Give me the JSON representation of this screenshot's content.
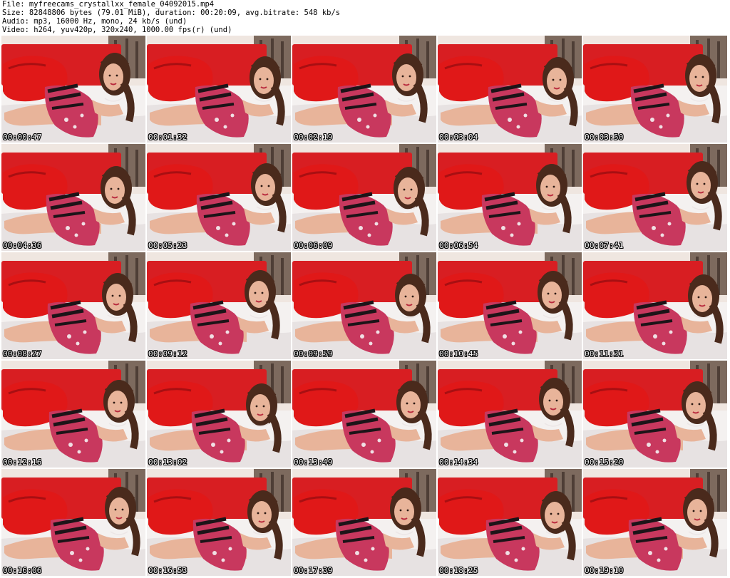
{
  "header": {
    "file": "File: myfreecams_crystallxx_female_04092015.mp4",
    "size": "Size: 82848806 bytes (79.01 MiB), duration: 00:20:09, avg.bitrate: 548 kb/s",
    "audio": "Audio: mp3, 16000 Hz, mono, 24 kb/s (und)",
    "video": "Video: h264, yuv420p, 320x240, 1000.00 fps(r) (und)"
  },
  "grid": {
    "columns": 5,
    "rows": 5,
    "timestamps": [
      "00:00:47",
      "00:01:32",
      "00:02:19",
      "00:03:04",
      "00:03:50",
      "00:04:36",
      "00:05:23",
      "00:06:09",
      "00:06:54",
      "00:07:41",
      "00:08:27",
      "00:09:12",
      "00:09:59",
      "00:10:45",
      "00:11:31",
      "00:12:16",
      "00:13:02",
      "00:13:49",
      "00:14:34",
      "00:15:20",
      "00:16:06",
      "00:16:53",
      "00:17:39",
      "00:18:25",
      "00:19:10"
    ]
  },
  "colors": {
    "headboard": "#d81e22",
    "pillow": "#e01818",
    "wall": "#efe6e0",
    "sheet": "#f4f1f0",
    "hair": "#4a2a1c",
    "skin": "#e8b49a",
    "dress": "#c8385e",
    "stripes": "#1c1418"
  }
}
